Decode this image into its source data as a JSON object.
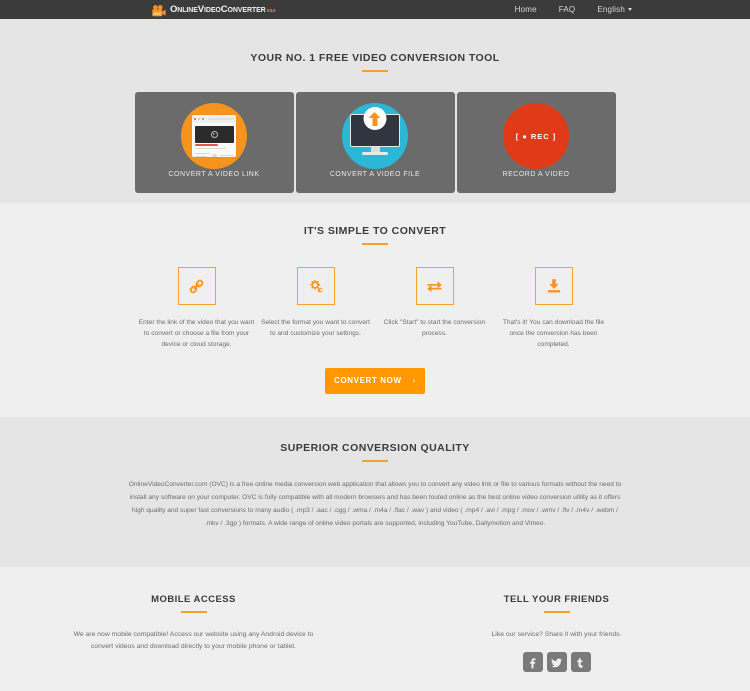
{
  "header": {
    "logo": {
      "name": "OnlineVideoConverter",
      "version": "v3.0",
      "icon": "video-camera-icon"
    },
    "nav": [
      {
        "label": "Home",
        "name": "nav-home"
      },
      {
        "label": "FAQ",
        "name": "nav-faq"
      },
      {
        "label": "English",
        "name": "nav-language"
      }
    ]
  },
  "hero": {
    "title": "YOUR NO. 1 FREE VIDEO CONVERSION TOOL",
    "cards": [
      {
        "label": "CONVERT A VIDEO LINK",
        "icon": "browser-video-icon",
        "color": "#f7941e"
      },
      {
        "label": "CONVERT A VIDEO FILE",
        "icon": "monitor-upload-icon",
        "color": "#2bb7d6"
      },
      {
        "label": "RECORD A VIDEO",
        "icon": "rec-icon",
        "color": "#e03a18",
        "badge": "[ ● REC ]"
      }
    ]
  },
  "steps_section": {
    "title": "IT'S SIMPLE TO CONVERT",
    "steps": [
      {
        "icon": "link-icon",
        "text": "Enter the link of the video that you want to convert or choose a file from your device or cloud storage."
      },
      {
        "icon": "cogs-icon",
        "text": "Select the format you want to convert to and customize your settings."
      },
      {
        "icon": "exchange-icon",
        "text": "Click \"Start\" to start the conversion process."
      },
      {
        "icon": "download-icon",
        "text": "That's it! You can download the file once the conversion has been completed."
      }
    ],
    "cta": {
      "label": "CONVERT NOW",
      "chevron": "›"
    }
  },
  "quality_section": {
    "title": "SUPERIOR CONVERSION QUALITY",
    "body": "OnlineVideoConverter.com (OVC) is a free online media conversion web application that allows you to convert any video link or file to various formats without the need to install any software on your computer. OVC is fully compatible with all modern browsers and has been touted online as the best online video conversion utility as it offers high quality and super fast conversions to many audio ( .mp3 / .aac / .ogg / .wma / .m4a / .flac / .wav ) and video ( .mp4 / .avi / .mpg / .mov / .wmv / .flv / .m4v / .webm / .mkv / .3gp ) formats. A wide range of online video portals are supported, including YouTube, Dailymotion and Vimeo."
  },
  "footer": {
    "mobile": {
      "title": "MOBILE ACCESS",
      "text": "We are now mobile compatible! Access our website using any Android device to convert videos and download directly to your mobile phone or tablet."
    },
    "share": {
      "title": "TELL YOUR FRIENDS",
      "text": "Like our service? Share it with your friends.",
      "socials": [
        {
          "name": "facebook-icon",
          "glyph": "f"
        },
        {
          "name": "twitter-icon",
          "glyph": "t"
        },
        {
          "name": "tumblr-icon",
          "glyph": "t"
        }
      ]
    }
  },
  "colors": {
    "accent": "#f5a22d",
    "cta": "#ff9800",
    "header_bg": "#3b3b3b",
    "card_bg": "#6b6b6b"
  }
}
